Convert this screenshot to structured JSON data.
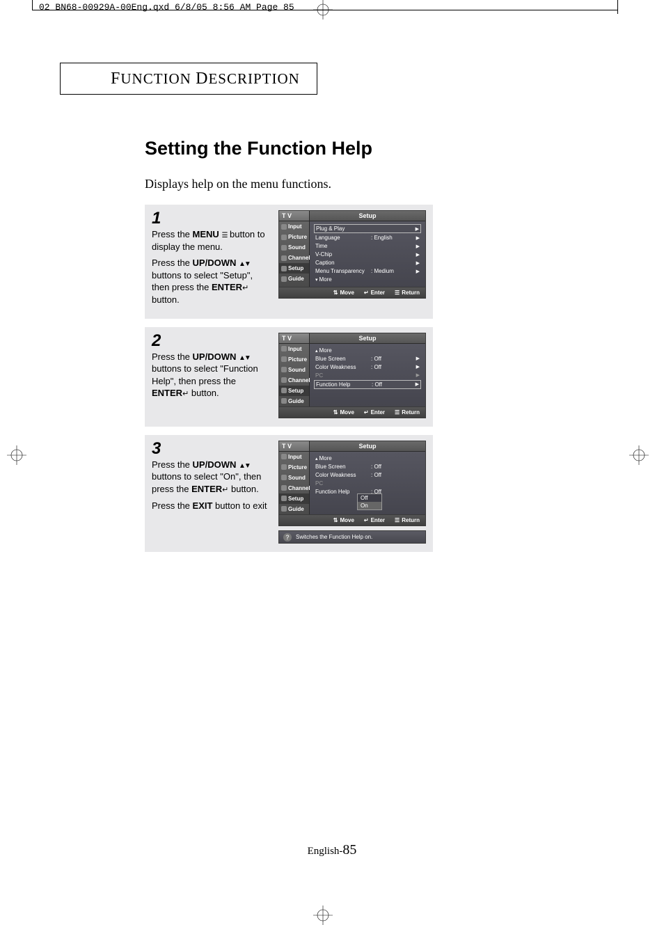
{
  "print_header": "02 BN68-00929A-00Eng.qxd  6/8/05 8:56 AM  Page 85",
  "section_header": "Function Description",
  "page_title": "Setting the Function Help",
  "intro": "Displays help on the menu functions.",
  "footer_prefix": "English-",
  "footer_page": "85",
  "osd_common": {
    "tv": "T V",
    "title": "Setup",
    "sidebar": [
      "Input",
      "Picture",
      "Sound",
      "Channel",
      "Setup",
      "Guide"
    ],
    "bottom": {
      "move": "Move",
      "enter": "Enter",
      "return": "Return"
    }
  },
  "steps": [
    {
      "num": "1",
      "paras": [
        "Press the <b>MENU</b> <span class='icon-menu' data-name='menu-icon' data-interactable='false'>☰</span>  button to display the menu.",
        "Press the <b>UP/DOWN</b> <span class='icon-ud' data-name='up-down-icon' data-interactable='false'>▲▼</span> buttons to select \"Setup\", then press the <b>ENTER</b><span class='icon-enter' data-name='enter-icon' data-interactable='false'>↵</span> button."
      ],
      "osd_rows": [
        {
          "label": "Plug & Play",
          "value": "",
          "arrow": true,
          "boxed": true
        },
        {
          "label": "Language",
          "value": ": English",
          "arrow": true
        },
        {
          "label": "Time",
          "value": "",
          "arrow": true
        },
        {
          "label": "V-Chip",
          "value": "",
          "arrow": true
        },
        {
          "label": "Caption",
          "value": "",
          "arrow": true
        },
        {
          "label": "Menu Transparency",
          "value": ": Medium",
          "arrow": true
        },
        {
          "label": "More",
          "value": "",
          "arrow": false,
          "more": "down"
        }
      ]
    },
    {
      "num": "2",
      "paras": [
        "Press the <b>UP/DOWN</b> <span class='icon-ud' data-name='up-down-icon' data-interactable='false'>▲▼</span> buttons  to select \"Function Help\", then press the <b>ENTER</b><span class='icon-enter' data-name='enter-icon' data-interactable='false'>↵</span> button."
      ],
      "osd_rows": [
        {
          "label": "More",
          "value": "",
          "arrow": false,
          "more": "up"
        },
        {
          "label": "Blue Screen",
          "value": ": Off",
          "arrow": true
        },
        {
          "label": "Color Weakness",
          "value": ": Off",
          "arrow": true
        },
        {
          "label": "PC",
          "value": "",
          "arrow": true,
          "disabled": true
        },
        {
          "label": "Function Help",
          "value": ": Off",
          "arrow": true,
          "boxed": true
        }
      ]
    },
    {
      "num": "3",
      "paras": [
        "Press the <b>UP/DOWN</b> <span class='icon-ud' data-name='up-down-icon' data-interactable='false'>▲▼</span> buttons  to select \"On\", then press the <b>ENTER</b><span class='icon-enter' data-name='enter-icon' data-interactable='false'>↵</span> button.",
        "Press the <b>EXIT</b> button to exit"
      ],
      "osd_rows": [
        {
          "label": "More",
          "value": "",
          "arrow": false,
          "more": "up"
        },
        {
          "label": "Blue Screen",
          "value": ": Off",
          "arrow": false
        },
        {
          "label": "Color Weakness",
          "value": ": Off",
          "arrow": false
        },
        {
          "label": "PC",
          "value": "",
          "arrow": false,
          "disabled": true
        },
        {
          "label": "Function Help",
          "value": ": Off",
          "arrow": false
        }
      ],
      "popup": {
        "options": [
          "Off",
          "On"
        ],
        "selected": "On"
      },
      "hint": "Switches the Function Help on."
    }
  ]
}
